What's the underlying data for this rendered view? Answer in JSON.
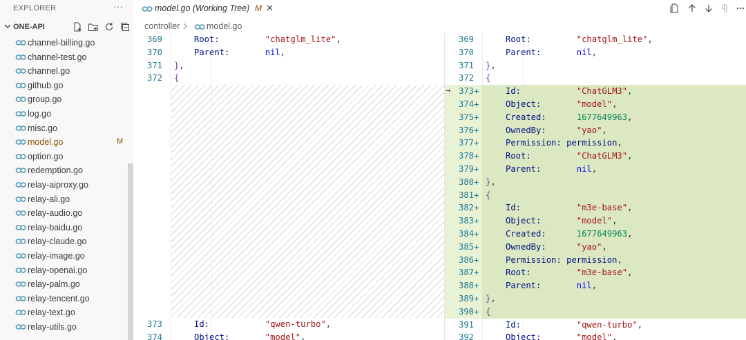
{
  "explorer": {
    "title": "EXPLORER",
    "more": "···",
    "project": "ONE-API",
    "files": [
      {
        "name": "channel-billing.go",
        "badge": ""
      },
      {
        "name": "channel-test.go",
        "badge": ""
      },
      {
        "name": "channel.go",
        "badge": ""
      },
      {
        "name": "github.go",
        "badge": ""
      },
      {
        "name": "group.go",
        "badge": ""
      },
      {
        "name": "log.go",
        "badge": ""
      },
      {
        "name": "misc.go",
        "badge": ""
      },
      {
        "name": "model.go",
        "badge": "M"
      },
      {
        "name": "option.go",
        "badge": ""
      },
      {
        "name": "redemption.go",
        "badge": ""
      },
      {
        "name": "relay-aiproxy.go",
        "badge": ""
      },
      {
        "name": "relay-ali.go",
        "badge": ""
      },
      {
        "name": "relay-audio.go",
        "badge": ""
      },
      {
        "name": "relay-baidu.go",
        "badge": ""
      },
      {
        "name": "relay-claude.go",
        "badge": ""
      },
      {
        "name": "relay-image.go",
        "badge": ""
      },
      {
        "name": "relay-openai.go",
        "badge": ""
      },
      {
        "name": "relay-palm.go",
        "badge": ""
      },
      {
        "name": "relay-tencent.go",
        "badge": ""
      },
      {
        "name": "relay-text.go",
        "badge": ""
      },
      {
        "name": "relay-utils.go",
        "badge": ""
      }
    ]
  },
  "tab": {
    "label": "model.go (Working Tree)",
    "badge": "M",
    "close": "✕"
  },
  "breadcrumb": {
    "folder": "controller",
    "file": "model.go"
  },
  "colors": {
    "added_bg": "#dbe8c1",
    "line_number": "#237893",
    "string": "#a31515",
    "number": "#098658",
    "keyword_nil": "#0000ff",
    "modified": "#895503"
  },
  "diff": {
    "left": {
      "top": [
        {
          "ln": "369",
          "tokens": [
            [
              "k",
              "Root:"
            ],
            [
              "p",
              "         "
            ],
            [
              "s",
              "\"chatglm_lite\""
            ],
            [
              "p",
              ","
            ]
          ],
          "indent": 2
        },
        {
          "ln": "370",
          "tokens": [
            [
              "k",
              "Parent:"
            ],
            [
              "p",
              "       "
            ],
            [
              "b",
              "nil"
            ],
            [
              "p",
              ","
            ]
          ],
          "indent": 2
        },
        {
          "ln": "371",
          "tokens": [
            [
              "br",
              "}"
            ],
            [
              "p",
              ","
            ]
          ],
          "indent": 1
        },
        {
          "ln": "372",
          "tokens": [
            [
              "br",
              "{"
            ]
          ],
          "indent": 1
        }
      ],
      "bottom": [
        {
          "ln": "373",
          "tokens": [
            [
              "k",
              "Id:"
            ],
            [
              "p",
              "           "
            ],
            [
              "s",
              "\"qwen-turbo\""
            ],
            [
              "p",
              ","
            ]
          ],
          "indent": 2
        },
        {
          "ln": "374",
          "tokens": [
            [
              "k",
              "Object:"
            ],
            [
              "p",
              "       "
            ],
            [
              "s",
              "\"model\""
            ],
            [
              "p",
              ","
            ]
          ],
          "indent": 2
        }
      ]
    },
    "right": [
      {
        "ln": "369",
        "mk": "",
        "tokens": [
          [
            "k",
            "Root:"
          ],
          [
            "p",
            "         "
          ],
          [
            "s",
            "\"chatglm_lite\""
          ],
          [
            "p",
            ","
          ]
        ],
        "indent": 2
      },
      {
        "ln": "370",
        "mk": "",
        "tokens": [
          [
            "k",
            "Parent:"
          ],
          [
            "p",
            "       "
          ],
          [
            "b",
            "nil"
          ],
          [
            "p",
            ","
          ]
        ],
        "indent": 2
      },
      {
        "ln": "371",
        "mk": "",
        "tokens": [
          [
            "br",
            "}"
          ],
          [
            "p",
            ","
          ]
        ],
        "indent": 1
      },
      {
        "ln": "372",
        "mk": "",
        "tokens": [
          [
            "br",
            "{"
          ]
        ],
        "indent": 1
      },
      {
        "ln": "373",
        "mk": "+",
        "arrow": "→",
        "tokens": [
          [
            "k",
            "Id:"
          ],
          [
            "p",
            "           "
          ],
          [
            "s",
            "\"ChatGLM3\""
          ],
          [
            "p",
            ","
          ]
        ],
        "indent": 2
      },
      {
        "ln": "374",
        "mk": "+",
        "tokens": [
          [
            "k",
            "Object:"
          ],
          [
            "p",
            "       "
          ],
          [
            "s",
            "\"model\""
          ],
          [
            "p",
            ","
          ]
        ],
        "indent": 2
      },
      {
        "ln": "375",
        "mk": "+",
        "tokens": [
          [
            "k",
            "Created:"
          ],
          [
            "p",
            "      "
          ],
          [
            "n",
            "1677649963"
          ],
          [
            "p",
            ","
          ]
        ],
        "indent": 2
      },
      {
        "ln": "376",
        "mk": "+",
        "tokens": [
          [
            "k",
            "OwnedBy:"
          ],
          [
            "p",
            "      "
          ],
          [
            "s",
            "\"yao\""
          ],
          [
            "p",
            ","
          ]
        ],
        "indent": 2
      },
      {
        "ln": "377",
        "mk": "+",
        "tokens": [
          [
            "k",
            "Permission:"
          ],
          [
            "p",
            " "
          ],
          [
            "k",
            "permission"
          ],
          [
            "p",
            ","
          ]
        ],
        "indent": 2
      },
      {
        "ln": "378",
        "mk": "+",
        "tokens": [
          [
            "k",
            "Root:"
          ],
          [
            "p",
            "         "
          ],
          [
            "s",
            "\"ChatGLM3\""
          ],
          [
            "p",
            ","
          ]
        ],
        "indent": 2
      },
      {
        "ln": "379",
        "mk": "+",
        "tokens": [
          [
            "k",
            "Parent:"
          ],
          [
            "p",
            "       "
          ],
          [
            "b",
            "nil"
          ],
          [
            "p",
            ","
          ]
        ],
        "indent": 2
      },
      {
        "ln": "380",
        "mk": "+",
        "tokens": [
          [
            "br",
            "}"
          ],
          [
            "p",
            ","
          ]
        ],
        "indent": 1
      },
      {
        "ln": "381",
        "mk": "+",
        "tokens": [
          [
            "br",
            "{"
          ]
        ],
        "indent": 1
      },
      {
        "ln": "382",
        "mk": "+",
        "tokens": [
          [
            "k",
            "Id:"
          ],
          [
            "p",
            "           "
          ],
          [
            "s",
            "\"m3e-base\""
          ],
          [
            "p",
            ","
          ]
        ],
        "indent": 2
      },
      {
        "ln": "383",
        "mk": "+",
        "tokens": [
          [
            "k",
            "Object:"
          ],
          [
            "p",
            "       "
          ],
          [
            "s",
            "\"model\""
          ],
          [
            "p",
            ","
          ]
        ],
        "indent": 2
      },
      {
        "ln": "384",
        "mk": "+",
        "tokens": [
          [
            "k",
            "Created:"
          ],
          [
            "p",
            "      "
          ],
          [
            "n",
            "1677649963"
          ],
          [
            "p",
            ","
          ]
        ],
        "indent": 2
      },
      {
        "ln": "385",
        "mk": "+",
        "tokens": [
          [
            "k",
            "OwnedBy:"
          ],
          [
            "p",
            "      "
          ],
          [
            "s",
            "\"yao\""
          ],
          [
            "p",
            ","
          ]
        ],
        "indent": 2
      },
      {
        "ln": "386",
        "mk": "+",
        "tokens": [
          [
            "k",
            "Permission:"
          ],
          [
            "p",
            " "
          ],
          [
            "k",
            "permission"
          ],
          [
            "p",
            ","
          ]
        ],
        "indent": 2
      },
      {
        "ln": "387",
        "mk": "+",
        "tokens": [
          [
            "k",
            "Root:"
          ],
          [
            "p",
            "         "
          ],
          [
            "s",
            "\"m3e-base\""
          ],
          [
            "p",
            ","
          ]
        ],
        "indent": 2
      },
      {
        "ln": "388",
        "mk": "+",
        "tokens": [
          [
            "k",
            "Parent:"
          ],
          [
            "p",
            "       "
          ],
          [
            "b",
            "nil"
          ],
          [
            "p",
            ","
          ]
        ],
        "indent": 2
      },
      {
        "ln": "389",
        "mk": "+",
        "tokens": [
          [
            "br",
            "}"
          ],
          [
            "p",
            ","
          ]
        ],
        "indent": 1
      },
      {
        "ln": "390",
        "mk": "+",
        "tokens": [
          [
            "br",
            "{"
          ]
        ],
        "indent": 1
      },
      {
        "ln": "391",
        "mk": "",
        "tokens": [
          [
            "k",
            "Id:"
          ],
          [
            "p",
            "           "
          ],
          [
            "s",
            "\"qwen-turbo\""
          ],
          [
            "p",
            ","
          ]
        ],
        "indent": 2
      },
      {
        "ln": "392",
        "mk": "",
        "tokens": [
          [
            "k",
            "Object:"
          ],
          [
            "p",
            "       "
          ],
          [
            "s",
            "\"model\""
          ],
          [
            "p",
            ","
          ]
        ],
        "indent": 2
      }
    ]
  }
}
